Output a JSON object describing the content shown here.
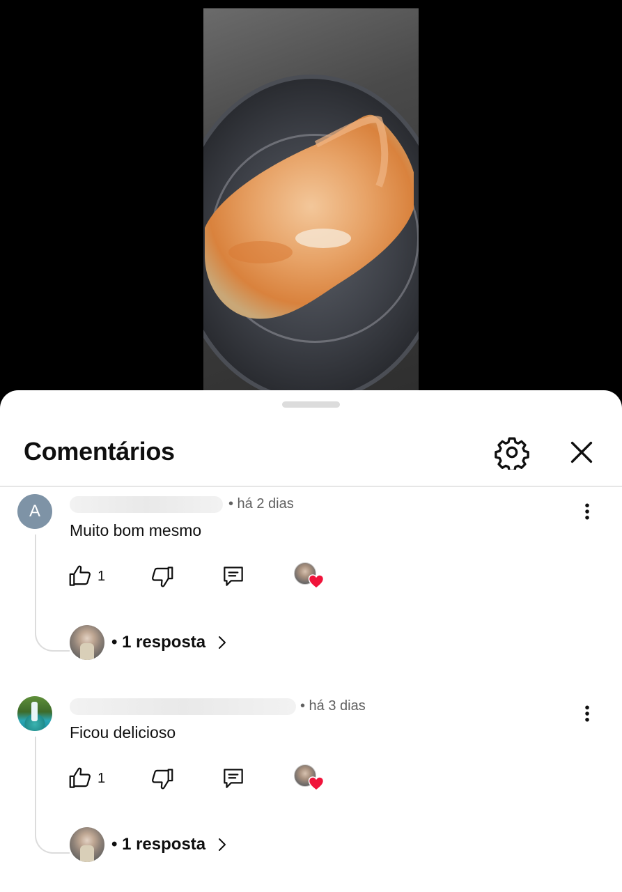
{
  "sheet": {
    "title": "Comentários"
  },
  "comments": [
    {
      "avatar_letter": "A",
      "avatar_kind": "letter",
      "meta": "• há 2 dias",
      "text": "Muito bom mesmo",
      "like_count": "1",
      "reply_text": "• 1 resposta"
    },
    {
      "avatar_letter": "",
      "avatar_kind": "waterfall-photo",
      "meta": "• há 3 dias",
      "text": "Ficou delicioso",
      "like_count": "1",
      "reply_text": "• 1 resposta"
    }
  ],
  "colors": {
    "heart": "#f0133a",
    "letter_avatar": "#7e93a6",
    "divider": "#e6e6e6",
    "thread_line": "#dcdcdc"
  },
  "icons": [
    "gear-icon",
    "close-icon",
    "more-vert-icon",
    "thumbs-up-icon",
    "thumbs-down-icon",
    "reply-comment-icon",
    "heart-icon",
    "chevron-right-icon"
  ]
}
